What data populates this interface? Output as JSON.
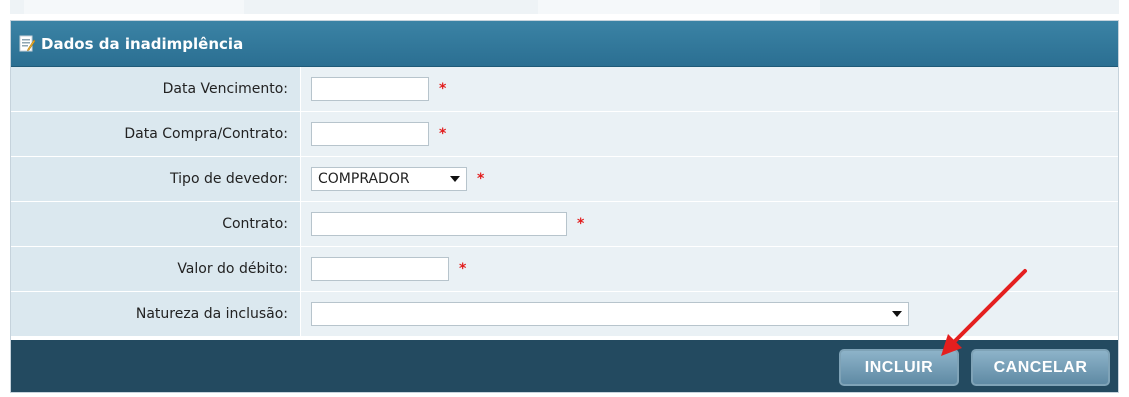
{
  "panel": {
    "title": "Dados da inadimplência",
    "icon": "edit-document-icon"
  },
  "form": {
    "data_vencimento_label": "Data Vencimento:",
    "data_vencimento_value": "",
    "data_compra_label": "Data Compra/Contrato:",
    "data_compra_value": "",
    "tipo_devedor_label": "Tipo de devedor:",
    "tipo_devedor_value": "COMPRADOR",
    "contrato_label": "Contrato:",
    "contrato_value": "",
    "valor_debito_label": "Valor do débito:",
    "valor_debito_value": "",
    "natureza_label": "Natureza da inclusão:",
    "natureza_value": "",
    "required_mark": "*"
  },
  "buttons": {
    "incluir": "INCLUIR",
    "cancelar": "CANCELAR"
  },
  "colors": {
    "header": "#2e7497",
    "footer": "#234a60",
    "label_bg": "#dbe8ef",
    "field_bg": "#eaf1f5",
    "required": "#e21c1c",
    "annotation_arrow": "#e41f1f"
  },
  "annotation": {
    "type": "red-arrow",
    "target": "incluir-button"
  }
}
